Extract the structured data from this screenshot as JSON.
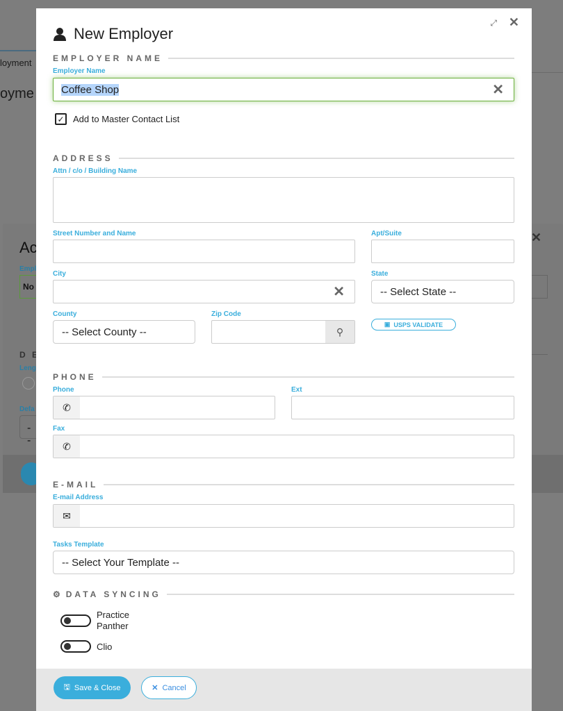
{
  "background": {
    "tab_fragment": "loyment",
    "heading_fragment": "oyme",
    "modal_title_fragment": "Ac",
    "label_fragment": "Empl",
    "value_fragment": "No",
    "section_fragment": "D E",
    "length_fragment": "Leng",
    "default_fragment": "Defa",
    "select_fragment": "--"
  },
  "modal": {
    "title": "New Employer",
    "icons": {
      "title": "user-icon",
      "expand": "expand-icon",
      "close": "close-icon"
    }
  },
  "employer_section": {
    "heading": "EMPLOYER NAME",
    "label": "Employer Name",
    "value": "Coffee Shop",
    "master_checkbox_label": "Add to Master Contact List",
    "master_checked": true
  },
  "address": {
    "heading": "ADDRESS",
    "attn_label": "Attn / c/o / Building Name",
    "street_label": "Street Number and Name",
    "apt_label": "Apt/Suite",
    "city_label": "City",
    "state_label": "State",
    "state_value": "-- Select State --",
    "county_label": "County",
    "county_value": "-- Select County --",
    "zip_label": "Zip Code",
    "usps_label": "USPS VALIDATE"
  },
  "phone": {
    "heading": "PHONE",
    "phone_label": "Phone",
    "ext_label": "Ext",
    "fax_label": "Fax"
  },
  "email": {
    "heading": "E-MAIL",
    "label": "E-mail Address"
  },
  "tasks": {
    "label": "Tasks Template",
    "value": "-- Select Your Template --"
  },
  "sync": {
    "heading": "DATA SYNCING",
    "items": [
      {
        "label_line1": "Practice",
        "label_line2": "Panther",
        "on": false
      },
      {
        "label_line1": "Clio",
        "on": false
      }
    ]
  },
  "footer": {
    "save_label": "Save & Close",
    "cancel_label": "Cancel"
  },
  "colors": {
    "accent": "#3aaedc",
    "focus": "#6ab03a"
  }
}
